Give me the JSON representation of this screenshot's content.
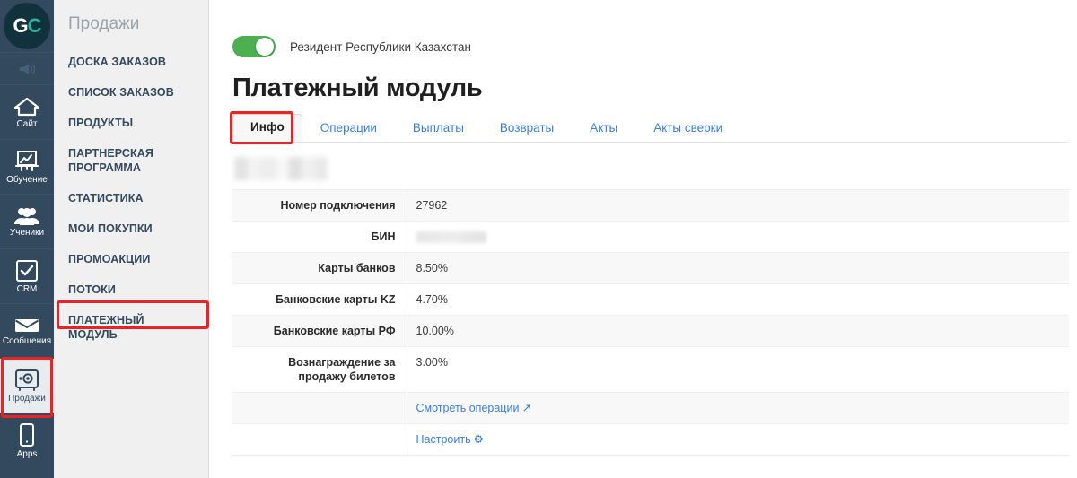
{
  "rail": {
    "logo": {
      "first": "G",
      "second": "C",
      "name": "gc-logo"
    },
    "items": [
      {
        "label": "",
        "icon": "megaphone-icon",
        "name": "announcements"
      },
      {
        "label": "Сайт",
        "icon": "home-icon",
        "name": "site"
      },
      {
        "label": "Обучение",
        "icon": "chart-board-icon",
        "name": "training"
      },
      {
        "label": "Ученики",
        "icon": "users-icon",
        "name": "students"
      },
      {
        "label": "CRM",
        "icon": "checkbox-icon",
        "name": "crm"
      },
      {
        "label": "Сообщения",
        "icon": "envelope-icon",
        "name": "messages"
      },
      {
        "label": "Продажи",
        "icon": "safe-icon",
        "name": "sales",
        "active": true
      },
      {
        "label": "Apps",
        "icon": "phone-icon",
        "name": "apps"
      }
    ]
  },
  "subnav": {
    "title": "Продажи",
    "items": [
      "ДОСКА ЗАКАЗОВ",
      "СПИСОК ЗАКАЗОВ",
      "ПРОДУКТЫ",
      "ПАРТНЕРСКАЯ ПРОГРАММА",
      "СТАТИСТИКА",
      "МОИ ПОКУПКИ",
      "ПРОМОАКЦИИ",
      "ПОТОКИ",
      "ПЛАТЕЖНЫЙ МОДУЛЬ"
    ],
    "active_index": 8
  },
  "header": {
    "toggle_label": "Резидент Республики Казахстан",
    "toggle_on": true,
    "title": "Платежный модуль"
  },
  "tabs": [
    {
      "label": "Инфо",
      "active": true
    },
    {
      "label": "Операции",
      "active": false
    },
    {
      "label": "Выплаты",
      "active": false
    },
    {
      "label": "Возвраты",
      "active": false
    },
    {
      "label": "Акты",
      "active": false
    },
    {
      "label": "Акты сверки",
      "active": false
    }
  ],
  "table": {
    "rows": [
      {
        "key": "Номер подключения",
        "value": "27962",
        "redacted": false
      },
      {
        "key": "БИН",
        "value": "",
        "redacted": true
      },
      {
        "key": "Карты банков",
        "value": "8.50%",
        "redacted": false
      },
      {
        "key": "Банковские карты KZ",
        "value": "4.70%",
        "redacted": false
      },
      {
        "key": "Банковские карты РФ",
        "value": "10.00%",
        "redacted": false
      },
      {
        "key": "Вознаграждение за продажу билетов",
        "value": "3.00%",
        "redacted": false
      }
    ],
    "links": [
      {
        "key": "",
        "label": "Смотреть операции",
        "icon": "external-link-icon"
      },
      {
        "key": "",
        "label": "Настроить",
        "icon": "gear-icon"
      }
    ]
  },
  "colors": {
    "rail_bg": "#32495e",
    "subnav_bg": "#f0f0f0",
    "accent_link": "#3b7dd8",
    "toggle_on": "#4caf50",
    "annotation": "#ee2222",
    "logo_teal": "#2bb3a3"
  }
}
